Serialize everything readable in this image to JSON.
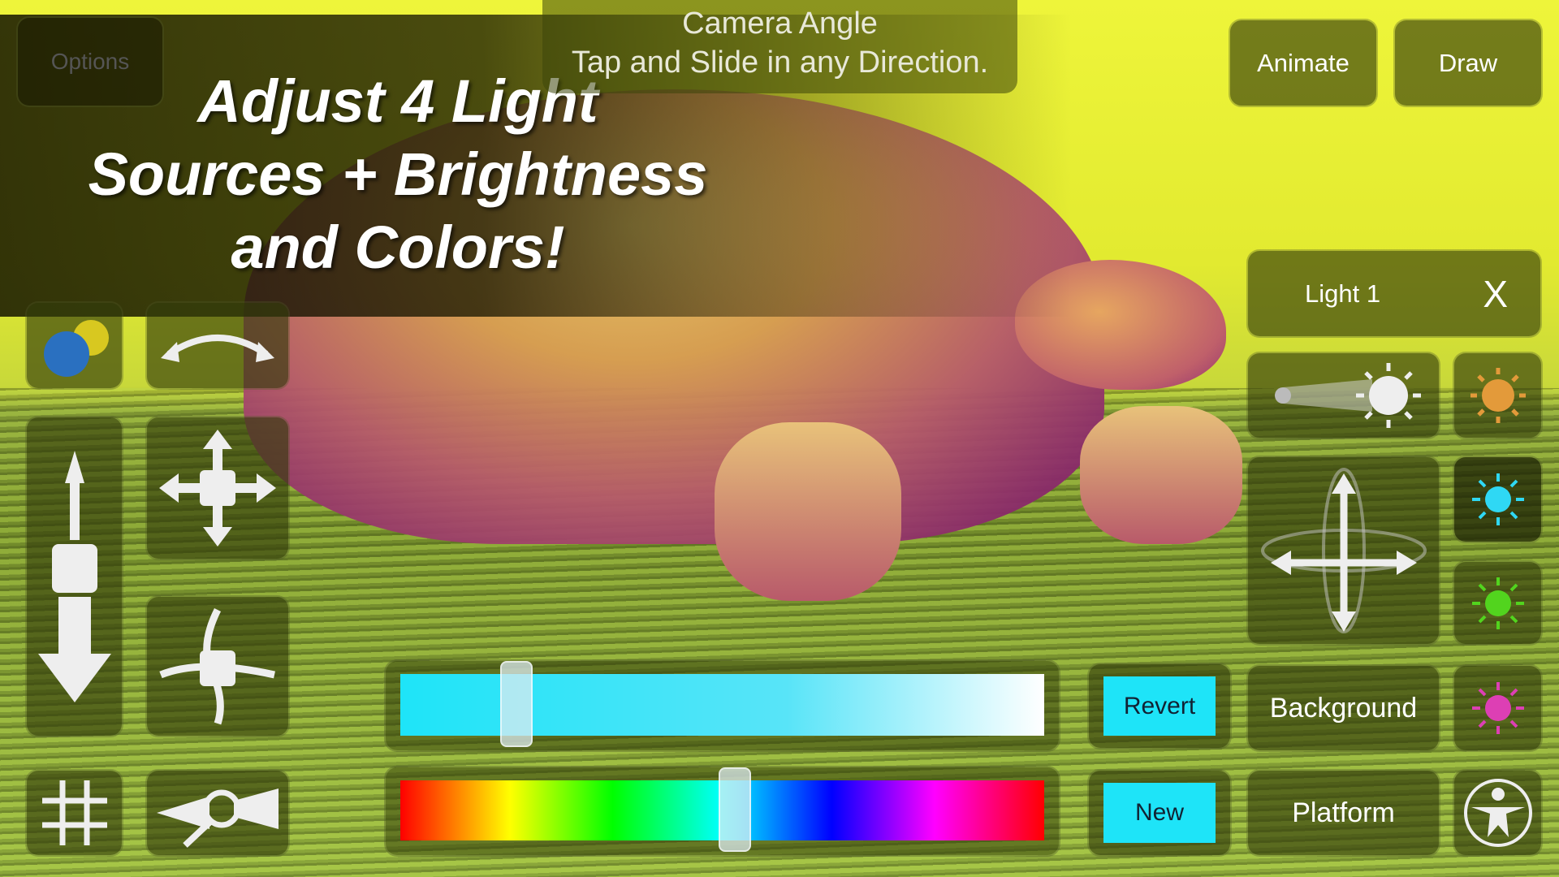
{
  "overlay_title": [
    "Adjust 4 Light",
    "Sources + Brightness",
    "and Colors!"
  ],
  "camera_hint": {
    "title": "Camera Angle",
    "subtitle": "Tap and Slide in any Direction."
  },
  "top_buttons": {
    "options": "Options",
    "animate": "Animate",
    "draw": "Draw"
  },
  "light_panel": {
    "label": "Light 1",
    "close": "X"
  },
  "light_colors": {
    "orange": "#e39a3a",
    "cyan": "#2fd8f4",
    "green": "#52d41e",
    "pink": "#dd3fb4"
  },
  "sliders": {
    "brightness_level_percent": 18,
    "hue_level_percent": 52,
    "brightness_color": "#1ee4f8"
  },
  "buttons": {
    "revert": "Revert",
    "new": "New",
    "background": "Background",
    "platform": "Platform"
  }
}
